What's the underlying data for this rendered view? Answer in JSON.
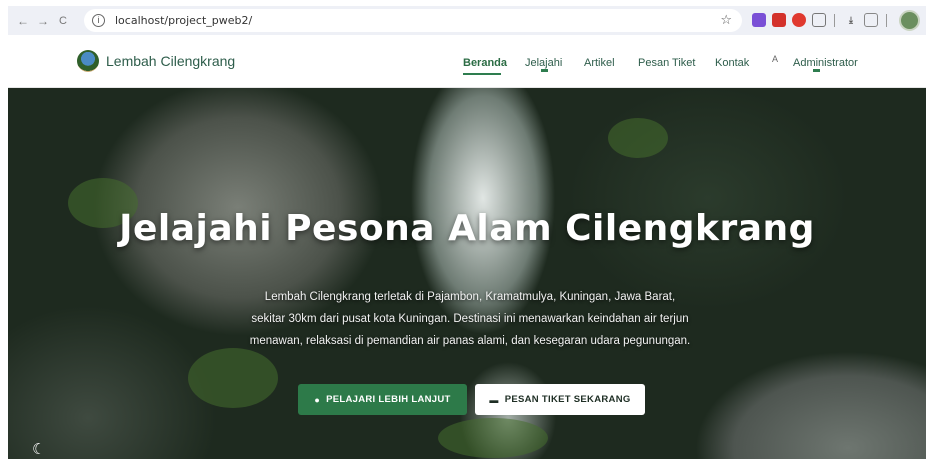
{
  "browser": {
    "url": "localhost/project_pweb2/",
    "back_icon": "←",
    "forward_icon": "→",
    "reload_icon": "C",
    "info_icon": "i",
    "star_icon": "☆"
  },
  "site": {
    "brand": "Lembah Cilengkrang",
    "nav": [
      {
        "label": "Beranda"
      },
      {
        "label": "Jelajahi"
      },
      {
        "label": "Artikel"
      },
      {
        "label": "Pesan Tiket"
      },
      {
        "label": "Kontak"
      },
      {
        "label": "Administrator"
      }
    ],
    "admin_img_alt": "A",
    "accent": "#2e7d4f"
  },
  "hero": {
    "title": "Jelajahi Pesona Alam Cilengkrang",
    "description": "Lembah Cilengkrang terletak di Pajambon, Kramatmulya, Kuningan, Jawa Barat, sekitar 30km dari pusat kota Kuningan. Destinasi ini menawarkan keindahan air terjun menawan, relaksasi di pemandian air panas alami, dan kesegaran udara pegunungan.",
    "btn_learn": "PELAJARI LEBIH LANJUT",
    "btn_ticket": "PESAN TIKET SEKARANG",
    "btn_learn_icon": "●",
    "btn_ticket_icon": "▬",
    "moon_icon": "☾"
  }
}
